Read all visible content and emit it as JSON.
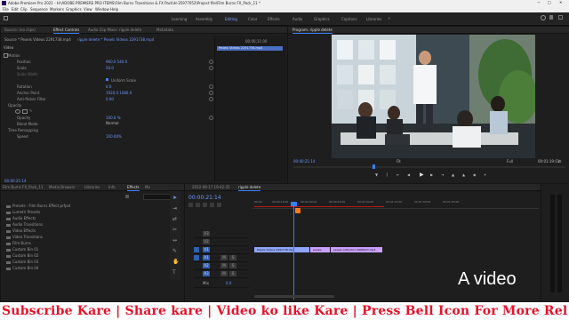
{
  "titlebar": {
    "title": "Adobe Premiere Pro 2021 - H:\\ADOBE PREMIERE PRO ITEMS\\Film Burns Transitions & FX Pack\\H-35977052\\Project file\\Film Burns FX_Pack_11 *"
  },
  "menubar": {
    "items": [
      "File",
      "Edit",
      "Clip",
      "Sequence",
      "Markers",
      "Graphics",
      "View",
      "Window",
      "Help"
    ]
  },
  "workspaces": {
    "items": [
      "Learning",
      "Assembly",
      "Editing",
      "Color",
      "Effects",
      "Audio",
      "Graphics",
      "Captions",
      "Libraries"
    ],
    "active": "Editing"
  },
  "effect_controls": {
    "tabs": [
      "Source: (no clips)",
      "Effect Controls",
      "Audio Clip Mixer: ripple delete",
      "Metadata"
    ],
    "source_line": "Source * Pexels Videos 2291738.mp4",
    "seq_line": "ripple delete * Pexels Videos 2291738.mp4",
    "section_video": "Video",
    "motion": "Motion",
    "rows": [
      {
        "label": "Position",
        "value": "960.0   540.0"
      },
      {
        "label": "Scale",
        "value": "50.0"
      },
      {
        "label": "Scale Width",
        "value": ""
      },
      {
        "label": "",
        "value": "Uniform Scale"
      },
      {
        "label": "Rotation",
        "value": "0.0"
      },
      {
        "label": "Anchor Point",
        "value": "1920.0   1080.0"
      },
      {
        "label": "Anti-flicker Filter",
        "value": "0.00"
      }
    ],
    "opacity": "Opacity",
    "opacity_rows": [
      {
        "label": "Opacity",
        "value": "100.0 %"
      },
      {
        "label": "Blend Mode",
        "value": "Normal"
      }
    ],
    "time_remap": "Time Remapping",
    "speed": {
      "label": "Speed",
      "value": "100.00%"
    },
    "mini_time": "00;00;11;00",
    "mini_clip": "Pexels Videos 2291738.mp4",
    "footer_time": "00:00:21:14"
  },
  "program": {
    "title": "Program: ripple delete",
    "timecode": "00:00:21:14",
    "fit": "Fit",
    "full": "Full",
    "duration": "00:01:19:01"
  },
  "project": {
    "tabs": [
      "Film Burns FX_Pack_11",
      "Media Browser",
      "Libraries",
      "Info",
      "Effects",
      "Ma"
    ],
    "items": [
      "Presets - Film Burns Effect.prfpst",
      "Lumetri Presets",
      "Audio Effects",
      "Audio Transitions",
      "Video Effects",
      "Video Transitions",
      "Film Burns",
      "Custom Bin 01",
      "Custom Bin 02",
      "Custom Bin 03",
      "Custom Bin 04"
    ]
  },
  "timeline": {
    "tabs": [
      "2022-09-17 19-42-35",
      "ripple delete"
    ],
    "timecode": "00:00:21:14",
    "ruler": [
      "00;00",
      "00;00;15;00",
      "00;00;30;00",
      "00;00;45;00",
      "00;01;00;00",
      "00;01;15;00",
      "00;01;30;00",
      "00;01;45;00"
    ],
    "video_tracks": [
      "V3",
      "V2",
      "V1"
    ],
    "audio_tracks": [
      "A1",
      "A2",
      "A3"
    ],
    "master": "Mix",
    "master_val": "0.0",
    "clips": [
      {
        "label": "Pexels Videos 2291738.mp4",
        "color": "#8fa6ff"
      },
      {
        "label": "pexels",
        "color": "#c9a0ff"
      },
      {
        "label": "pexels-cottonbro-5668923.mp4",
        "color": "#c9a0ff"
      }
    ]
  },
  "overlay": {
    "caption": "A video",
    "banner": "Subscribe Kare | Share kare | Video ko like Kare | Press Bell Icon For More Rel"
  }
}
